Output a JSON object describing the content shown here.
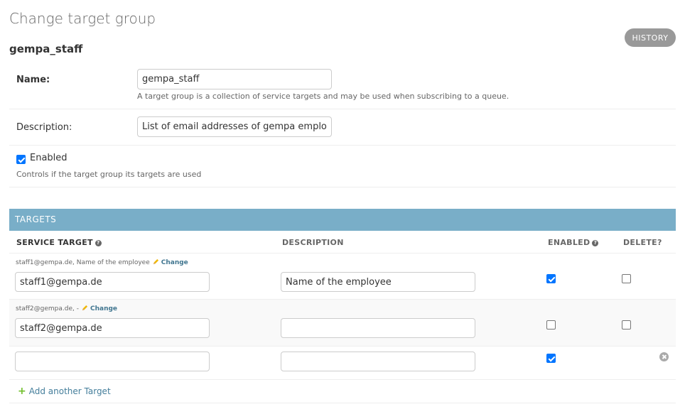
{
  "page": {
    "title": "Change target group",
    "object_title": "gempa_staff",
    "history_label": "HISTORY"
  },
  "fields": {
    "name": {
      "label": "Name:",
      "value": "gempa_staff",
      "help": "A target group is a collection of service targets and may be used when subscribing to a queue."
    },
    "description": {
      "label": "Description:",
      "value": "List of email addresses of gempa employees"
    },
    "enabled": {
      "label": "Enabled",
      "checked": true,
      "help": "Controls if the target group its targets are used"
    }
  },
  "targets": {
    "caption": "TARGETS",
    "columns": {
      "service_target": "SERVICE TARGET",
      "description": "DESCRIPTION",
      "enabled": "ENABLED",
      "delete": "DELETE?"
    },
    "rows": [
      {
        "original": "staff1@gempa.de, Name of the employee",
        "change_label": "Change",
        "service_target": "staff1@gempa.de",
        "description": "Name of the employee",
        "enabled": true,
        "delete": false
      },
      {
        "original": "staff2@gempa.de, -",
        "change_label": "Change",
        "service_target": "staff2@gempa.de",
        "description": "",
        "enabled": false,
        "delete": false
      },
      {
        "original": "",
        "service_target": "",
        "description": "",
        "enabled": true
      }
    ],
    "add_label": "Add another Target"
  },
  "colors": {
    "caption_bg": "#79aec8",
    "link": "#417690",
    "add_icon": "#70bf2b",
    "checkbox": "#0075ff"
  }
}
